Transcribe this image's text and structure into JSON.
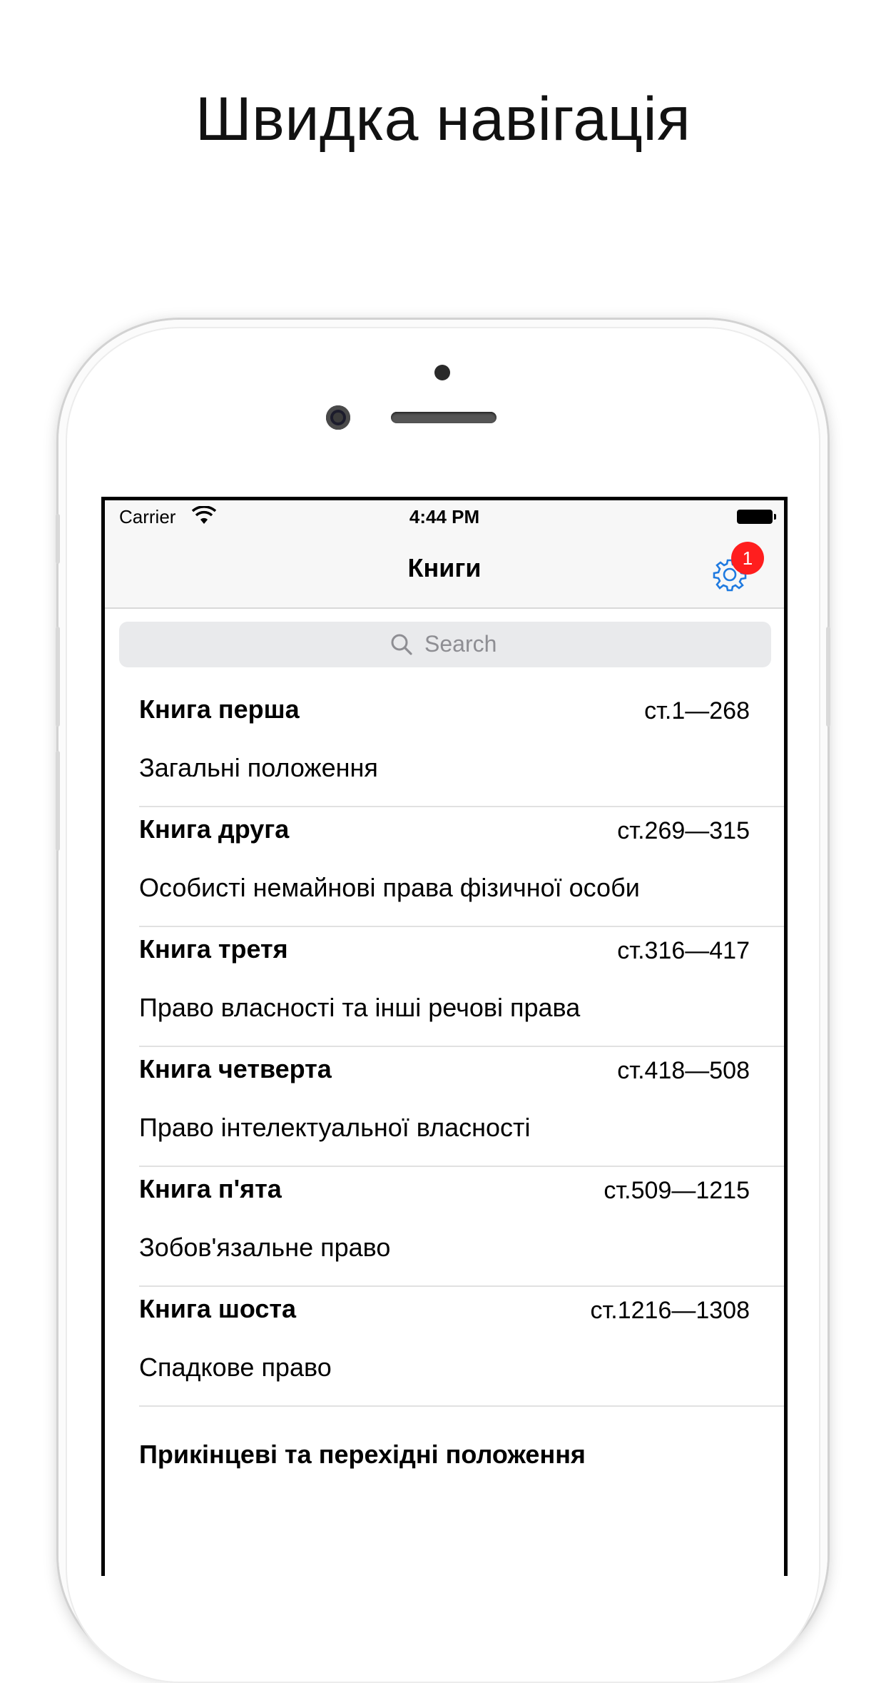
{
  "headline": "Швидка навігація",
  "status_bar": {
    "carrier": "Carrier",
    "time": "4:44 PM",
    "wifi_icon": "wifi-icon",
    "battery_icon": "battery-icon"
  },
  "navbar": {
    "title": "Книги",
    "settings_icon": "gear-icon",
    "settings_badge": "1",
    "accent_color": "#1f7ae0",
    "badge_color": "#ff1e1e"
  },
  "search": {
    "placeholder": "Search",
    "icon": "search-icon"
  },
  "books": [
    {
      "title": "Книга перша",
      "range": "ст.1—268",
      "subtitle": "Загальні положення"
    },
    {
      "title": "Книга друга",
      "range": "ст.269—315",
      "subtitle": "Особисті немайнові права фізичної особи"
    },
    {
      "title": "Книга третя",
      "range": "ст.316—417",
      "subtitle": "Право власності та інші речові права"
    },
    {
      "title": "Книга четверта",
      "range": "ст.418—508",
      "subtitle": "Право інтелектуальної власності"
    },
    {
      "title": "Книга п'ята",
      "range": "ст.509—1215",
      "subtitle": "Зобов'язальне право"
    },
    {
      "title": "Книга шоста",
      "range": "ст.1216—1308",
      "subtitle": "Спадкове право"
    }
  ],
  "final_section": "Прикінцеві та перехідні положення"
}
